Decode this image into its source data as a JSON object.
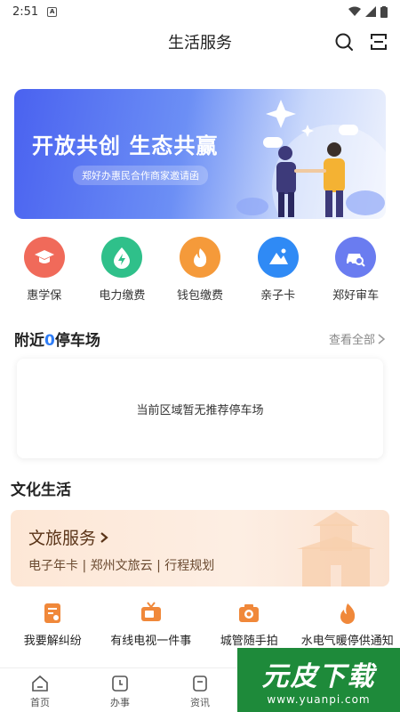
{
  "status": {
    "time": "2:51",
    "sim_label": "A"
  },
  "header": {
    "title": "生活服务"
  },
  "banner": {
    "title": "开放共创 生态共赢",
    "subtitle": "郑好办惠民合作商家邀请函"
  },
  "services": [
    {
      "label": "惠学保",
      "icon": "graduation-cap-icon",
      "color": "#f06a5a"
    },
    {
      "label": "电力缴费",
      "icon": "lightning-drop-icon",
      "color": "#2fc08a"
    },
    {
      "label": "钱包缴费",
      "icon": "flame-icon",
      "color": "#f59a3a"
    },
    {
      "label": "亲子卡",
      "icon": "mountain-icon",
      "color": "#2f8af5"
    },
    {
      "label": "郑好审车",
      "icon": "car-search-icon",
      "color": "#6a7cf0"
    }
  ],
  "parking": {
    "title_prefix": "附近",
    "count": "0",
    "title_suffix": "停车场",
    "more_label": "查看全部",
    "empty_text": "当前区域暂无推荐停车场"
  },
  "culture": {
    "section_title": "文化生活",
    "card_title": "文旅服务",
    "card_subtitle": "电子年卡 | 郑州文旅云 | 行程规划"
  },
  "quick_links": [
    {
      "label": "我要解纠纷",
      "icon": "document-icon"
    },
    {
      "label": "有线电视一件事",
      "icon": "tv-icon"
    },
    {
      "label": "城管随手拍",
      "icon": "camera-icon"
    },
    {
      "label": "水电气暖停供通知",
      "icon": "flame-icon"
    }
  ],
  "tabs": [
    {
      "label": "首页",
      "icon": "home-icon"
    },
    {
      "label": "办事",
      "icon": "clock-icon"
    },
    {
      "label": "资讯",
      "icon": "news-icon"
    },
    {
      "label": "",
      "icon": ""
    },
    {
      "label": "",
      "icon": ""
    }
  ],
  "watermark": {
    "title": "元皮下载",
    "url": "www.yuanpi.com"
  },
  "colors": {
    "accent": "#2f7df6",
    "orange": "#f0883a",
    "tour_bg": "#fde7d6"
  }
}
